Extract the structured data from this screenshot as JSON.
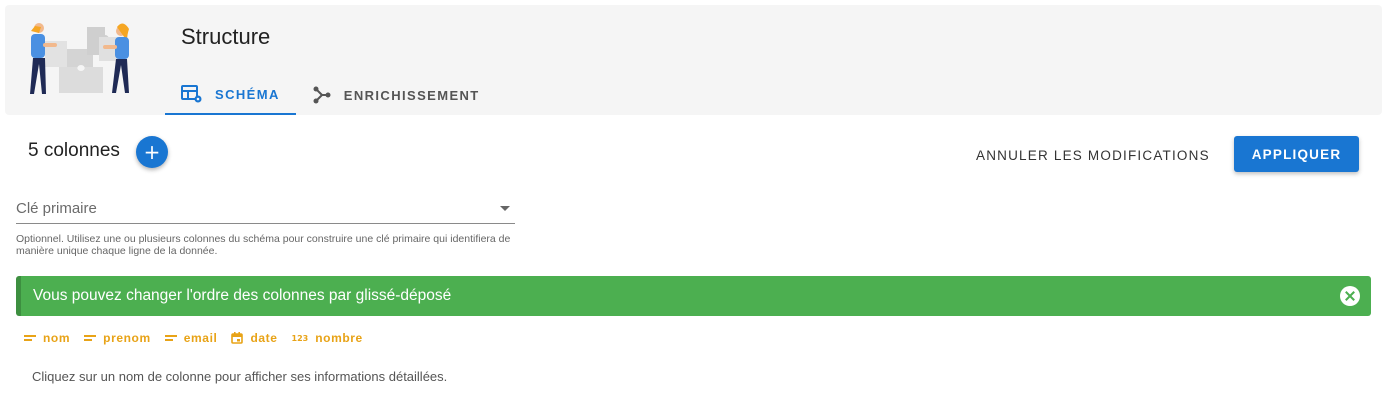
{
  "header": {
    "title": "Structure",
    "tabs": [
      {
        "label": "SCHÉMA",
        "icon": "table-settings-icon",
        "active": true
      },
      {
        "label": "ENRICHISSEMENT",
        "icon": "graph-nodes-icon",
        "active": false
      }
    ]
  },
  "toolbar": {
    "columns_count": "5 colonnes",
    "add_label": "+",
    "cancel_label": "ANNULER LES MODIFICATIONS",
    "apply_label": "APPLIQUER"
  },
  "primary_key": {
    "label": "Clé primaire",
    "hint": "Optionnel. Utilisez une ou plusieurs colonnes du schéma pour construire une clé primaire qui identifiera de manière unique chaque ligne de la donnée."
  },
  "alert": {
    "message": "Vous pouvez changer l'ordre des colonnes par glissé-déposé"
  },
  "columns": [
    {
      "name": "nom",
      "icon": "text-type-icon"
    },
    {
      "name": "prenom",
      "icon": "text-type-icon"
    },
    {
      "name": "email",
      "icon": "text-type-icon"
    },
    {
      "name": "date",
      "icon": "calendar-icon"
    },
    {
      "name": "nombre",
      "icon": "number-type-icon",
      "icon_text": "123"
    }
  ],
  "info": "Cliquez sur un nom de colonne pour afficher ses informations détaillées.",
  "colors": {
    "accent": "#1976d2",
    "success": "#4caf50",
    "column_chip": "#e8a317"
  }
}
